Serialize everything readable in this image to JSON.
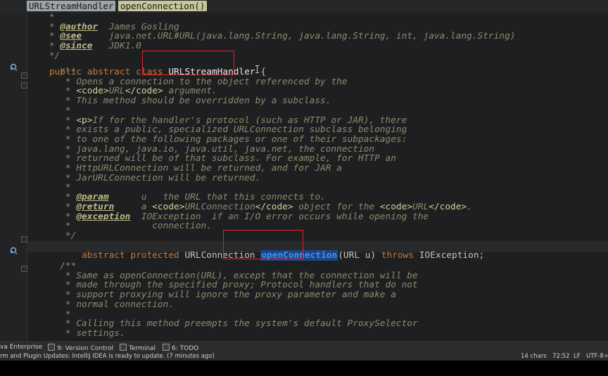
{
  "breadcrumb": {
    "class_crumb": "URLStreamHandler",
    "method_crumb": "openConnection()"
  },
  "editor": {
    "header_lines": [
      {
        "parts": [
          {
            "t": "    *",
            "c": "cm"
          }
        ]
      },
      {
        "parts": [
          {
            "t": "    * ",
            "c": "cm"
          },
          {
            "t": "@author",
            "c": "jd"
          },
          {
            "t": "  James Gosling",
            "c": "cm"
          }
        ]
      },
      {
        "parts": [
          {
            "t": "    * ",
            "c": "cm"
          },
          {
            "t": "@see",
            "c": "jd"
          },
          {
            "t": "     java.net.URL#URL(java.lang.String, java.lang.String, int, java.lang.String)",
            "c": "cm"
          }
        ]
      },
      {
        "parts": [
          {
            "t": "    * ",
            "c": "cm"
          },
          {
            "t": "@since",
            "c": "jd"
          },
          {
            "t": "   JDK1.0",
            "c": "cm"
          }
        ]
      },
      {
        "parts": [
          {
            "t": "    */",
            "c": "cm"
          }
        ]
      }
    ],
    "class_decl": {
      "prefix": "public abstract class ",
      "name": "URLStreamHandler",
      "suffix": " {"
    },
    "doc1": [
      {
        "parts": [
          {
            "t": "      /**",
            "c": "cm"
          }
        ]
      },
      {
        "parts": [
          {
            "t": "       * Opens a connection to the object referenced by the",
            "c": "cm"
          }
        ]
      },
      {
        "parts": [
          {
            "t": "       * ",
            "c": "cm"
          },
          {
            "t": "<code>",
            "c": "tag"
          },
          {
            "t": "URL",
            "c": "cm"
          },
          {
            "t": "</code>",
            "c": "tag"
          },
          {
            "t": " argument.",
            "c": "cm"
          }
        ]
      },
      {
        "parts": [
          {
            "t": "       * This method should be overridden by a subclass.",
            "c": "cm"
          }
        ]
      },
      {
        "parts": [
          {
            "t": "       *",
            "c": "cm"
          }
        ]
      },
      {
        "parts": [
          {
            "t": "       * ",
            "c": "cm"
          },
          {
            "t": "<p>",
            "c": "tag"
          },
          {
            "t": "If for the handler's protocol (such as HTTP or JAR), there",
            "c": "cm"
          }
        ]
      },
      {
        "parts": [
          {
            "t": "       * exists a public, specialized URLConnection subclass belonging",
            "c": "cm"
          }
        ]
      },
      {
        "parts": [
          {
            "t": "       * to one of the following packages or one of their subpackages:",
            "c": "cm"
          }
        ]
      },
      {
        "parts": [
          {
            "t": "       * java.lang, java.io, java.util, java.net, the connection",
            "c": "cm"
          }
        ]
      },
      {
        "parts": [
          {
            "t": "       * returned will be of that subclass. For example, for HTTP an",
            "c": "cm"
          }
        ]
      },
      {
        "parts": [
          {
            "t": "       * HttpURLConnection will be returned, and for JAR a",
            "c": "cm"
          }
        ]
      },
      {
        "parts": [
          {
            "t": "       * JarURLConnection will be returned.",
            "c": "cm"
          }
        ]
      },
      {
        "parts": [
          {
            "t": "       *",
            "c": "cm"
          }
        ]
      },
      {
        "parts": [
          {
            "t": "       * ",
            "c": "cm"
          },
          {
            "t": "@param",
            "c": "jd"
          },
          {
            "t": "      u   the URL that this connects to.",
            "c": "cm"
          }
        ]
      },
      {
        "parts": [
          {
            "t": "       * ",
            "c": "cm"
          },
          {
            "t": "@return",
            "c": "jd"
          },
          {
            "t": "     a ",
            "c": "cm"
          },
          {
            "t": "<code>",
            "c": "tag"
          },
          {
            "t": "URLConnection",
            "c": "cm"
          },
          {
            "t": "</code>",
            "c": "tag"
          },
          {
            "t": " object for the ",
            "c": "cm"
          },
          {
            "t": "<code>",
            "c": "tag"
          },
          {
            "t": "URL",
            "c": "cm"
          },
          {
            "t": "</code>",
            "c": "tag"
          },
          {
            "t": ".",
            "c": "cm"
          }
        ]
      },
      {
        "parts": [
          {
            "t": "       * ",
            "c": "cm"
          },
          {
            "t": "@exception",
            "c": "jd"
          },
          {
            "t": "  IOException  if an I/O error occurs while opening the",
            "c": "cm"
          }
        ]
      },
      {
        "parts": [
          {
            "t": "       *               connection.",
            "c": "cm"
          }
        ]
      },
      {
        "parts": [
          {
            "t": "       */",
            "c": "cm"
          }
        ]
      }
    ],
    "method_decl": {
      "indent": "      ",
      "kw1": "abstract protected ",
      "type": "URLConnection ",
      "name": "openConnection",
      "args": "(URL u) ",
      "kw2": "throws",
      "tail": " IOException;"
    },
    "doc2": [
      {
        "parts": [
          {
            "t": "      /**",
            "c": "cm"
          }
        ]
      },
      {
        "parts": [
          {
            "t": "       * Same as openConnection(URL), except that the connection will be",
            "c": "cm"
          }
        ]
      },
      {
        "parts": [
          {
            "t": "       * made through the specified proxy; Protocol handlers that do not",
            "c": "cm"
          }
        ]
      },
      {
        "parts": [
          {
            "t": "       * support proxying will ignore the proxy parameter and make a",
            "c": "cm"
          }
        ]
      },
      {
        "parts": [
          {
            "t": "       * normal connection.",
            "c": "cm"
          }
        ]
      },
      {
        "parts": [
          {
            "t": "       *",
            "c": "cm"
          }
        ]
      },
      {
        "parts": [
          {
            "t": "       * Calling this method preempts the system's default ProxySelector",
            "c": "cm"
          }
        ]
      },
      {
        "parts": [
          {
            "t": "       * settings.",
            "c": "cm"
          }
        ]
      }
    ]
  },
  "toolwindows": {
    "enterprise": "va Enterprise",
    "version_control": "9: Version Control",
    "terminal": "Terminal",
    "todo": "6: TODO"
  },
  "status": {
    "message": "rm and Plugin Updates: IntelliJ IDEA is ready to update. (7 minutes ago)",
    "selection": "14 chars",
    "position": "72:52",
    "line_sep": "LF",
    "encoding": "UTF-8÷"
  },
  "colors": {
    "accent_red": "#e0252a",
    "identifier_highlight": "#214283",
    "keyword": "#cc7832"
  }
}
